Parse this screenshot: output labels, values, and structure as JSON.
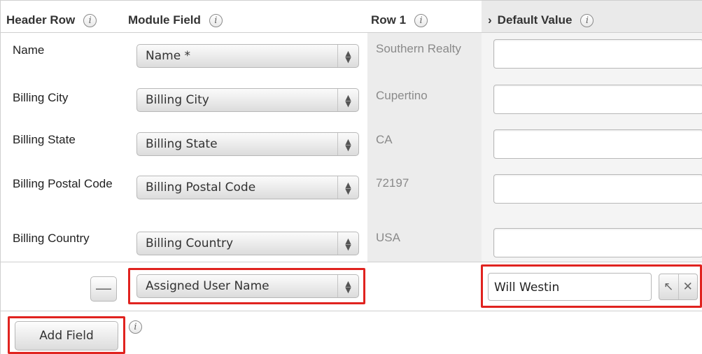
{
  "headers": {
    "header_row": "Header Row",
    "module_field": "Module Field",
    "row1": "Row 1",
    "default_value": "Default Value",
    "default_value_chevron": "›",
    "info_glyph": "i"
  },
  "rows": [
    {
      "header": "Name",
      "field": "Name *",
      "row1": "Southern Realty"
    },
    {
      "header": "Billing City",
      "field": "Billing City",
      "row1": "Cupertino"
    },
    {
      "header": "Billing State",
      "field": "Billing State",
      "row1": "CA"
    },
    {
      "header": "Billing Postal Code",
      "field": "Billing Postal Code",
      "row1": "72197"
    },
    {
      "header": "Billing Country",
      "field": "Billing Country",
      "row1": "USA"
    }
  ],
  "added_row": {
    "remove_label": "—",
    "field": "Assigned User Name",
    "default_value": "Will Westin",
    "select_icon": "↖",
    "clear_icon": "✕"
  },
  "add_field_label": "Add Field",
  "select_arrow_up": "▲",
  "select_arrow_down": "▼",
  "highlight_color": "#e0231f"
}
